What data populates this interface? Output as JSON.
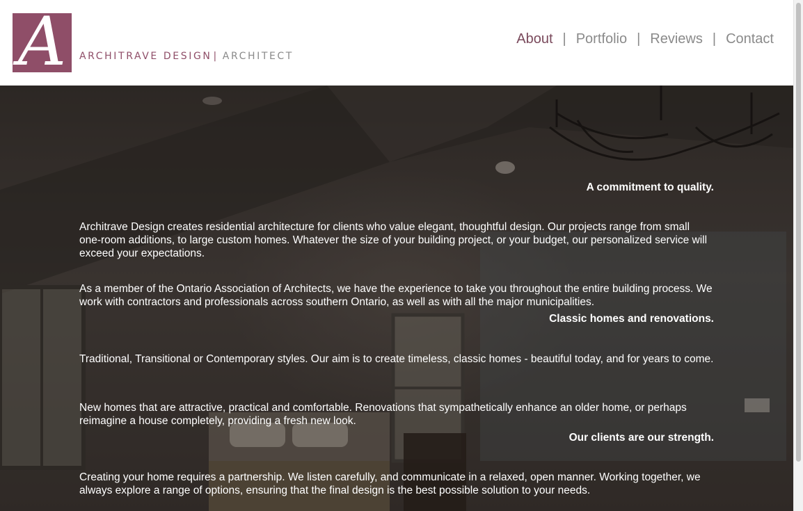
{
  "brand": {
    "logo_letter": "A",
    "name": "ARCHITRAVE DESIGN",
    "separator": "|",
    "role": "ARCHITECT",
    "color": "#8f4e68"
  },
  "nav": {
    "items": [
      {
        "label": "About",
        "active": true
      },
      {
        "label": "Portfolio",
        "active": false
      },
      {
        "label": "Reviews",
        "active": false
      },
      {
        "label": "Contact",
        "active": false
      }
    ],
    "divider": "|"
  },
  "sections": [
    {
      "heading": "A commitment to quality.",
      "paragraphs": [
        "Architrave Design creates residential architecture for clients who value elegant, thoughtful design. Our projects range from small one-room additions, to large custom homes. Whatever the size of your building project, or your budget, our personalized service will exceed your expectations.",
        "As a member of the Ontario Association of Architects, we have the experience to take you throughout the entire building process. We work with contractors and professionals across southern Ontario, as well as with all the major municipalities."
      ]
    },
    {
      "heading": "Classic homes and renovations.",
      "paragraphs": [
        "Traditional, Transitional or Contemporary styles. Our aim is to create timeless, classic homes - beautiful today, and for years to come.",
        "New homes that are attractive, practical and comfortable. Renovations that sympathetically enhance an older home, or perhaps reimagine a house completely, providing a fresh new look."
      ]
    },
    {
      "heading": "Our clients are our strength.",
      "paragraphs": [
        "Creating your home requires a partnership. We listen carefully, and communicate in a relaxed, open manner. Working together, we always explore a range of options, ensuring that the final design is the best possible solution to your needs."
      ]
    }
  ]
}
